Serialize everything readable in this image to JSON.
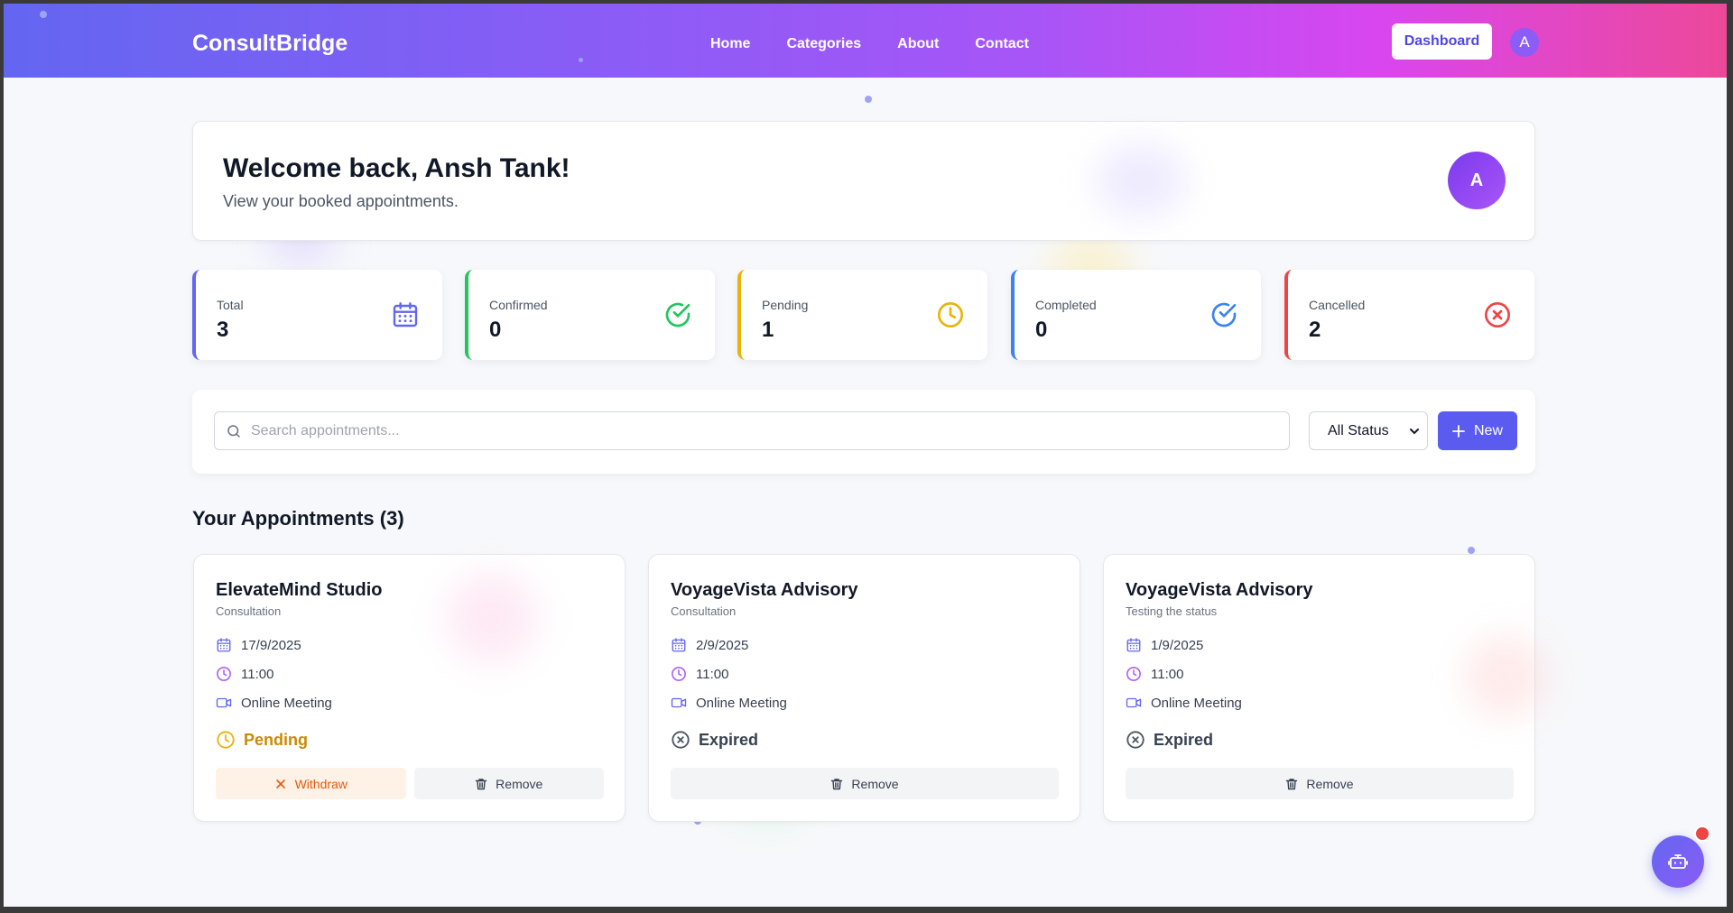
{
  "navbar": {
    "brand": "ConsultBridge",
    "links": [
      "Home",
      "Categories",
      "About",
      "Contact"
    ],
    "dashboard_label": "Dashboard",
    "avatar_initial": "A"
  },
  "welcome": {
    "title": "Welcome back, Ansh Tank!",
    "subtitle": "View your booked appointments.",
    "avatar_initial": "A"
  },
  "stats": [
    {
      "label": "Total",
      "value": "3",
      "color": "#6366f1",
      "icon": "calendar-icon"
    },
    {
      "label": "Confirmed",
      "value": "0",
      "color": "#22c55e",
      "icon": "check-circle-icon"
    },
    {
      "label": "Pending",
      "value": "1",
      "color": "#eab308",
      "icon": "clock-icon"
    },
    {
      "label": "Completed",
      "value": "0",
      "color": "#3b82f6",
      "icon": "check-circle-icon"
    },
    {
      "label": "Cancelled",
      "value": "2",
      "color": "#ef4444",
      "icon": "x-circle-icon"
    }
  ],
  "filter": {
    "search_placeholder": "Search appointments...",
    "status_selected": "All Status",
    "new_label": "New"
  },
  "section_title": "Your Appointments (3)",
  "appointments": [
    {
      "name": "ElevateMind Studio",
      "type": "Consultation",
      "date": "17/9/2025",
      "time": "11:00",
      "mode": "Online Meeting",
      "status": "Pending",
      "status_color": "#ca8a04",
      "withdraw_label": "Withdraw",
      "remove_label": "Remove"
    },
    {
      "name": "VoyageVista Advisory",
      "type": "Consultation",
      "date": "2/9/2025",
      "time": "11:00",
      "mode": "Online Meeting",
      "status": "Expired",
      "status_color": "#4b5563",
      "remove_label": "Remove"
    },
    {
      "name": "VoyageVista Advisory",
      "type": "Testing the status",
      "date": "1/9/2025",
      "time": "11:00",
      "mode": "Online Meeting",
      "status": "Expired",
      "status_color": "#4b5563",
      "remove_label": "Remove"
    }
  ],
  "colors": {
    "accent": "#5b5bf0",
    "date_icon": "#6366f1",
    "time_icon": "#a855f7"
  }
}
